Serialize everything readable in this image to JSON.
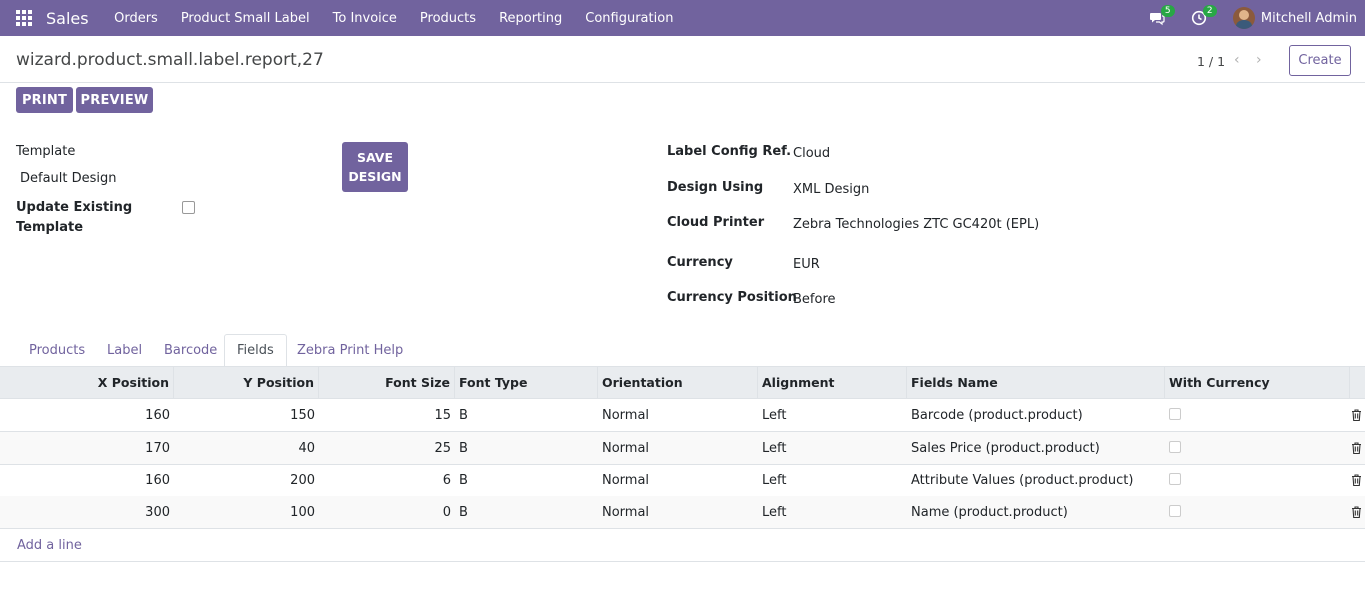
{
  "navbar": {
    "app_name": "Sales",
    "menu": [
      "Orders",
      "Product Small Label",
      "To Invoice",
      "Products",
      "Reporting",
      "Configuration"
    ],
    "messages_count": "5",
    "activities_count": "2",
    "user_name": "Mitchell Admin"
  },
  "control_panel": {
    "title": "wizard.product.small.label.report,27",
    "pager": "1 / 1",
    "create_label": "Create"
  },
  "actions": {
    "print_label": "PRINT",
    "preview_label": "PREVIEW"
  },
  "form": {
    "template_label": "Template",
    "template_value": "Default Design",
    "update_existing_label_line1": "Update Existing",
    "update_existing_label_line2": "Template",
    "save_design_line1": "SAVE",
    "save_design_line2": "DESIGN",
    "label_config_ref_label": "Label Config Ref.",
    "label_config_ref_value": "Cloud",
    "design_using_label": "Design Using",
    "design_using_value": "XML Design",
    "cloud_printer_label": "Cloud Printer",
    "cloud_printer_value": "Zebra Technologies ZTC GC420t (EPL)",
    "currency_label": "Currency",
    "currency_value": "EUR",
    "currency_position_label": "Currency Position",
    "currency_position_value": "Before"
  },
  "tabs": [
    "Products",
    "Label",
    "Barcode",
    "Fields",
    "Zebra Print Help"
  ],
  "active_tab": "Fields",
  "table": {
    "headers": [
      "X Position",
      "Y Position",
      "Font Size",
      "Font Type",
      "Orientation",
      "Alignment",
      "Fields Name",
      "With Currency"
    ],
    "rows": [
      {
        "x": "160",
        "y": "150",
        "size": "15",
        "type": "B",
        "orientation": "Normal",
        "alignment": "Left",
        "field": "Barcode (product.product)"
      },
      {
        "x": "170",
        "y": "40",
        "size": "25",
        "type": "B",
        "orientation": "Normal",
        "alignment": "Left",
        "field": "Sales Price (product.product)"
      },
      {
        "x": "160",
        "y": "200",
        "size": "6",
        "type": "B",
        "orientation": "Normal",
        "alignment": "Left",
        "field": "Attribute Values (product.product)"
      },
      {
        "x": "300",
        "y": "100",
        "size": "0",
        "type": "B",
        "orientation": "Normal",
        "alignment": "Left",
        "field": "Name (product.product)"
      }
    ],
    "add_line_label": "Add a line"
  },
  "colors": {
    "brand": "#71639e",
    "badge": "#28a745"
  }
}
